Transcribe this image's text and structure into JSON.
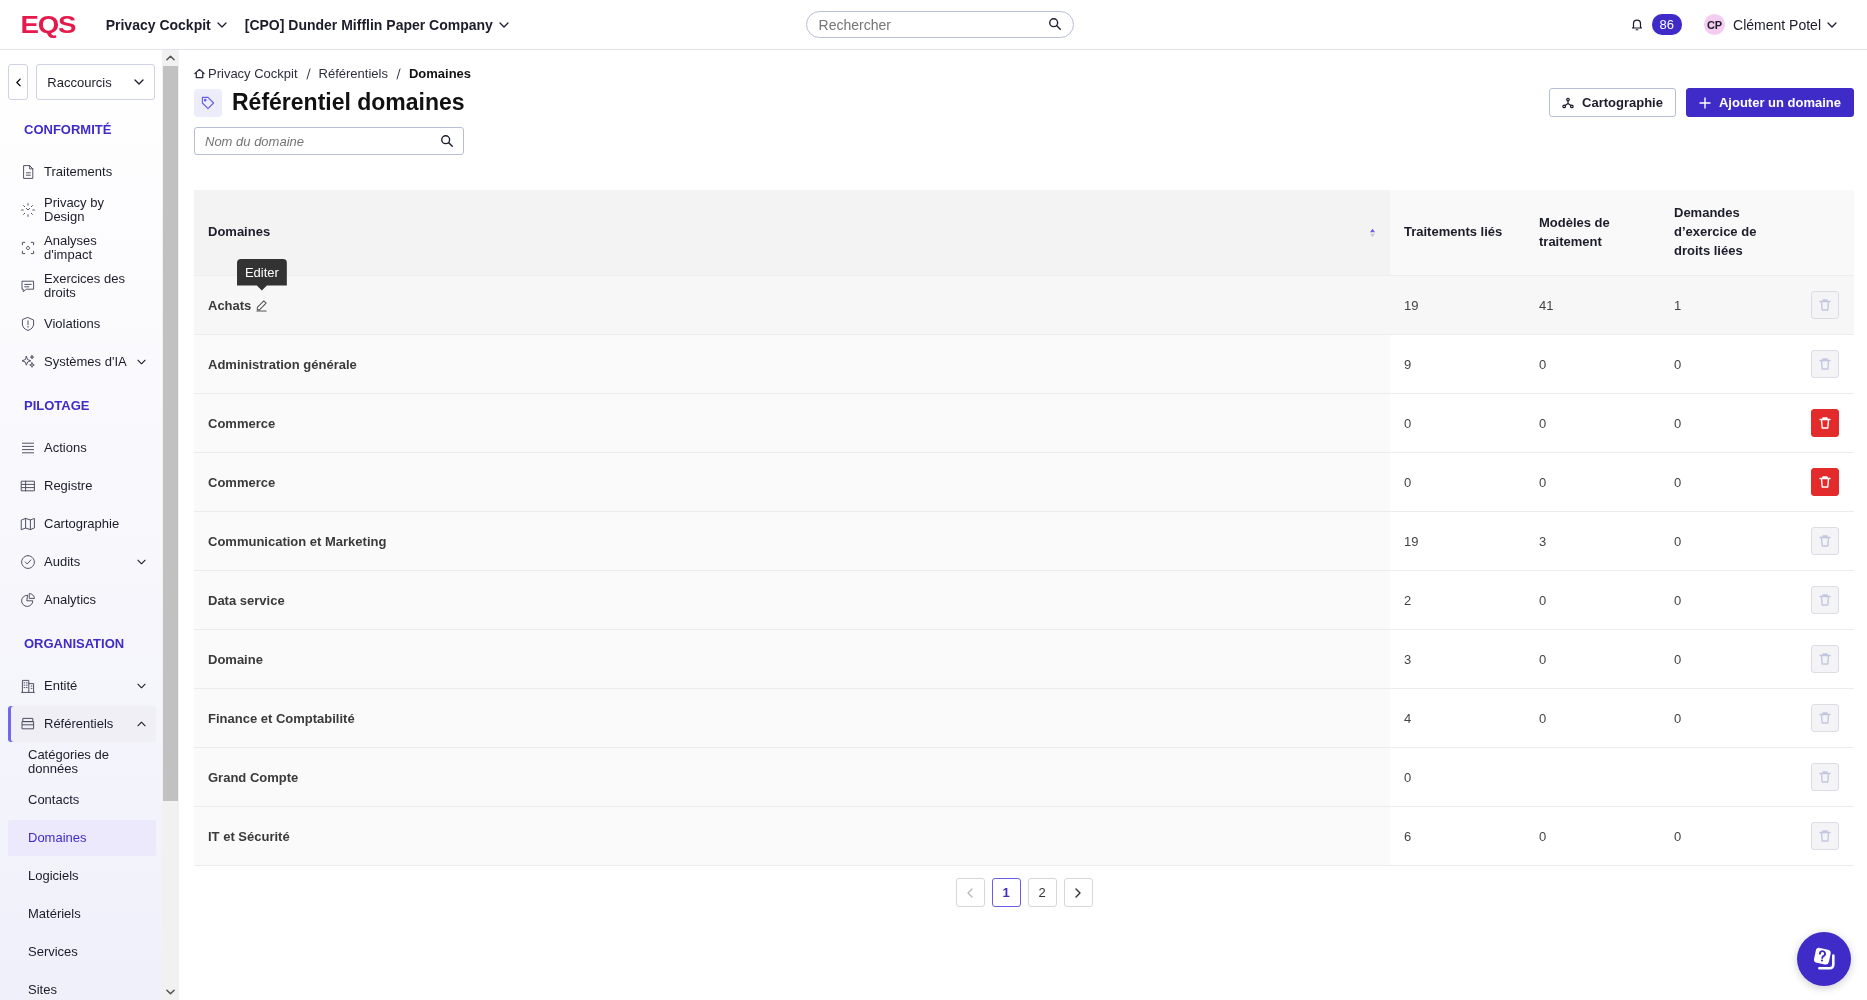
{
  "top_bar": {
    "logo": "EQS",
    "app_menu": "Privacy Cockpit",
    "company_menu": "[CPO] Dunder Mifflin Paper Company",
    "search": {
      "placeholder": "Rechercher"
    },
    "notifications": "86",
    "user": {
      "initials": "CP",
      "name": "Clément Potel"
    }
  },
  "sidebar": {
    "shortcuts": "Raccourcis",
    "sections": [
      {
        "title": "CONFORMITÉ",
        "items": [
          {
            "kind": "link",
            "label": "Traitements",
            "selected": false
          },
          {
            "kind": "link",
            "label": "Privacy by Design",
            "selected": false
          },
          {
            "kind": "link",
            "label": "Analyses d'impact",
            "selected": false
          },
          {
            "kind": "link",
            "label": "Exercices des droits",
            "selected": false
          },
          {
            "kind": "link",
            "label": "Violations",
            "selected": false
          },
          {
            "kind": "group",
            "label": "Systèmes d'IA",
            "selected": false,
            "expanded": false
          }
        ]
      },
      {
        "title": "PILOTAGE",
        "items": [
          {
            "kind": "link",
            "label": "Actions",
            "selected": false
          },
          {
            "kind": "link",
            "label": "Registre",
            "selected": false
          },
          {
            "kind": "link",
            "label": "Cartographie",
            "selected": false
          },
          {
            "kind": "group",
            "label": "Audits",
            "selected": false,
            "expanded": false
          },
          {
            "kind": "link",
            "label": "Analytics",
            "selected": false
          }
        ]
      },
      {
        "title": "ORGANISATION",
        "items": [
          {
            "kind": "group",
            "label": "Entité",
            "selected": false,
            "expanded": false
          },
          {
            "kind": "group",
            "label": "Référentiels",
            "selected": true,
            "expanded": true,
            "children": [
              {
                "label": "Catégories de données",
                "selected": false
              },
              {
                "label": "Contacts",
                "selected": false
              },
              {
                "label": "Domaines",
                "selected": true
              },
              {
                "label": "Logiciels",
                "selected": false
              },
              {
                "label": "Matériels",
                "selected": false
              },
              {
                "label": "Services",
                "selected": false
              },
              {
                "label": "Sites",
                "selected": false
              }
            ]
          }
        ]
      }
    ]
  },
  "breadcrumb": [
    "Privacy Cockpit",
    "Référentiels",
    "Domaines"
  ],
  "title": "Référentiel domaines",
  "actions": [
    {
      "kind": "secondary",
      "label": "Cartographie"
    },
    {
      "kind": "primary",
      "label": "Ajouter un domaine"
    }
  ],
  "filter": {
    "placeholder": "Nom du domaine"
  },
  "table": {
    "columns": [
      {
        "label": "Domaines",
        "sortable": true
      },
      {
        "label": "Traitements liés",
        "sortable": false
      },
      {
        "label": "Modèles de traitement",
        "sortable": false
      },
      {
        "label": "Demandes d’exercice de droits liées",
        "sortable": false
      }
    ],
    "rows": [
      {
        "domain": "Achats",
        "traitements": "19",
        "modeles": "41",
        "demandes": "1",
        "deletable": false,
        "hovered": true,
        "tooltip": "Editer"
      },
      {
        "domain": "Administration générale",
        "traitements": "9",
        "modeles": "0",
        "demandes": "0",
        "deletable": false,
        "hovered": false
      },
      {
        "domain": "Commerce",
        "traitements": "0",
        "modeles": "0",
        "demandes": "0",
        "deletable": true,
        "hovered": false
      },
      {
        "domain": "Commerce",
        "traitements": "0",
        "modeles": "0",
        "demandes": "0",
        "deletable": true,
        "hovered": false
      },
      {
        "domain": "Communication et Marketing",
        "traitements": "19",
        "modeles": "3",
        "demandes": "0",
        "deletable": false,
        "hovered": false
      },
      {
        "domain": "Data service",
        "traitements": "2",
        "modeles": "0",
        "demandes": "0",
        "deletable": false,
        "hovered": false
      },
      {
        "domain": "Domaine",
        "traitements": "3",
        "modeles": "0",
        "demandes": "0",
        "deletable": false,
        "hovered": false
      },
      {
        "domain": "Finance et Comptabilité",
        "traitements": "4",
        "modeles": "0",
        "demandes": "0",
        "deletable": false,
        "hovered": false
      },
      {
        "domain": "Grand Compte",
        "traitements": "0",
        "deletable": false,
        "hovered": false
      },
      {
        "domain": "IT et Sécurité",
        "traitements": "6",
        "modeles": "0",
        "demandes": "0",
        "deletable": false,
        "hovered": false
      }
    ]
  },
  "pagination": {
    "previous_disabled": true,
    "next_disabled": false,
    "pages": [
      {
        "label": "1",
        "selected": true
      },
      {
        "label": "2",
        "selected": false
      }
    ]
  }
}
